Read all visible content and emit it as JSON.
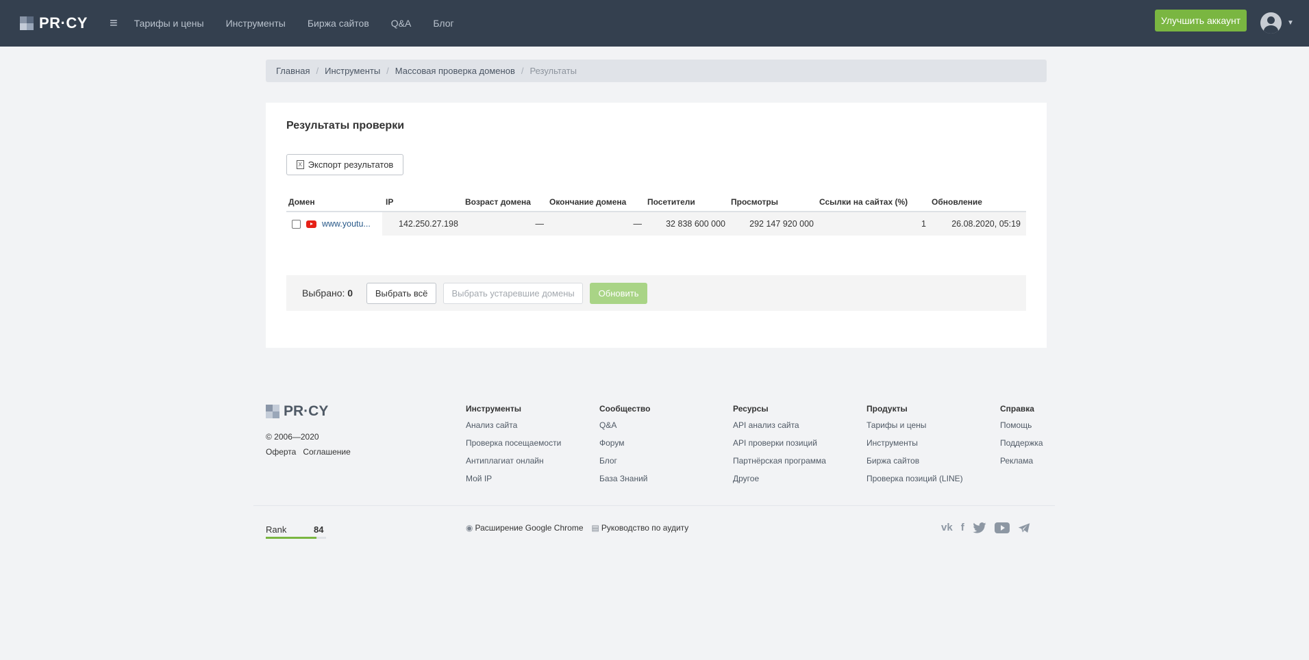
{
  "header": {
    "logo_text": "PR·CY",
    "nav": [
      "Тарифы и цены",
      "Инструменты",
      "Биржа сайтов",
      "Q&A",
      "Блог"
    ],
    "upgrade_label": "Улучшить аккаунт",
    "accent_color": "#7ab641"
  },
  "breadcrumb": {
    "items": [
      "Главная",
      "Инструменты",
      "Массовая проверка доменов"
    ],
    "current": "Результаты"
  },
  "results": {
    "title": "Результаты проверки",
    "export_label": "Экспорт результатов",
    "columns": [
      "Домен",
      "IP",
      "Возраст домена",
      "Окончание домена",
      "Посетители",
      "Просмотры",
      "Ссылки на сайтах (%)",
      "Обновление"
    ],
    "rows": [
      {
        "domain": "www.youtu...",
        "ip": "142.250.27.198",
        "age": "—",
        "expiry": "—",
        "visitors": "32 838 600 000",
        "views": "292 147 920 000",
        "links": "1",
        "updated": "26.08.2020, 05:19"
      }
    ]
  },
  "selection": {
    "label": "Выбрано:",
    "count": "0",
    "select_all": "Выбрать всё",
    "select_expired": "Выбрать устаревшие домены",
    "refresh": "Обновить"
  },
  "footer": {
    "logo_text": "PR·CY",
    "copyright": "© 2006—2020",
    "legal": [
      "Оферта",
      "Соглашение"
    ],
    "columns": [
      {
        "heading": "Инструменты",
        "links": [
          "Анализ сайта",
          "Проверка посещаемости",
          "Антиплагиат онлайн",
          "Мой IP"
        ]
      },
      {
        "heading": "Сообщество",
        "links": [
          "Q&A",
          "Форум",
          "Блог",
          "База Знаний"
        ]
      },
      {
        "heading": "Ресурсы",
        "links": [
          "API анализ сайта",
          "API проверки позиций",
          "Партнёрская программа",
          "Другое"
        ]
      },
      {
        "heading": "Продукты",
        "links": [
          "Тарифы и цены",
          "Инструменты",
          "Биржа сайтов",
          "Проверка позиций (LINE)"
        ]
      },
      {
        "heading": "Справка",
        "links": [
          "Помощь",
          "Поддержка",
          "Реклама"
        ]
      }
    ],
    "rank_label": "Rank",
    "rank_value": "84",
    "rank_fill_fraction": 0.84,
    "extension_link": "Расширение Google Chrome",
    "audit_link": "Руководство по аудиту",
    "social": [
      "vk-icon",
      "facebook-icon",
      "twitter-icon",
      "youtube-icon",
      "telegram-icon"
    ]
  }
}
